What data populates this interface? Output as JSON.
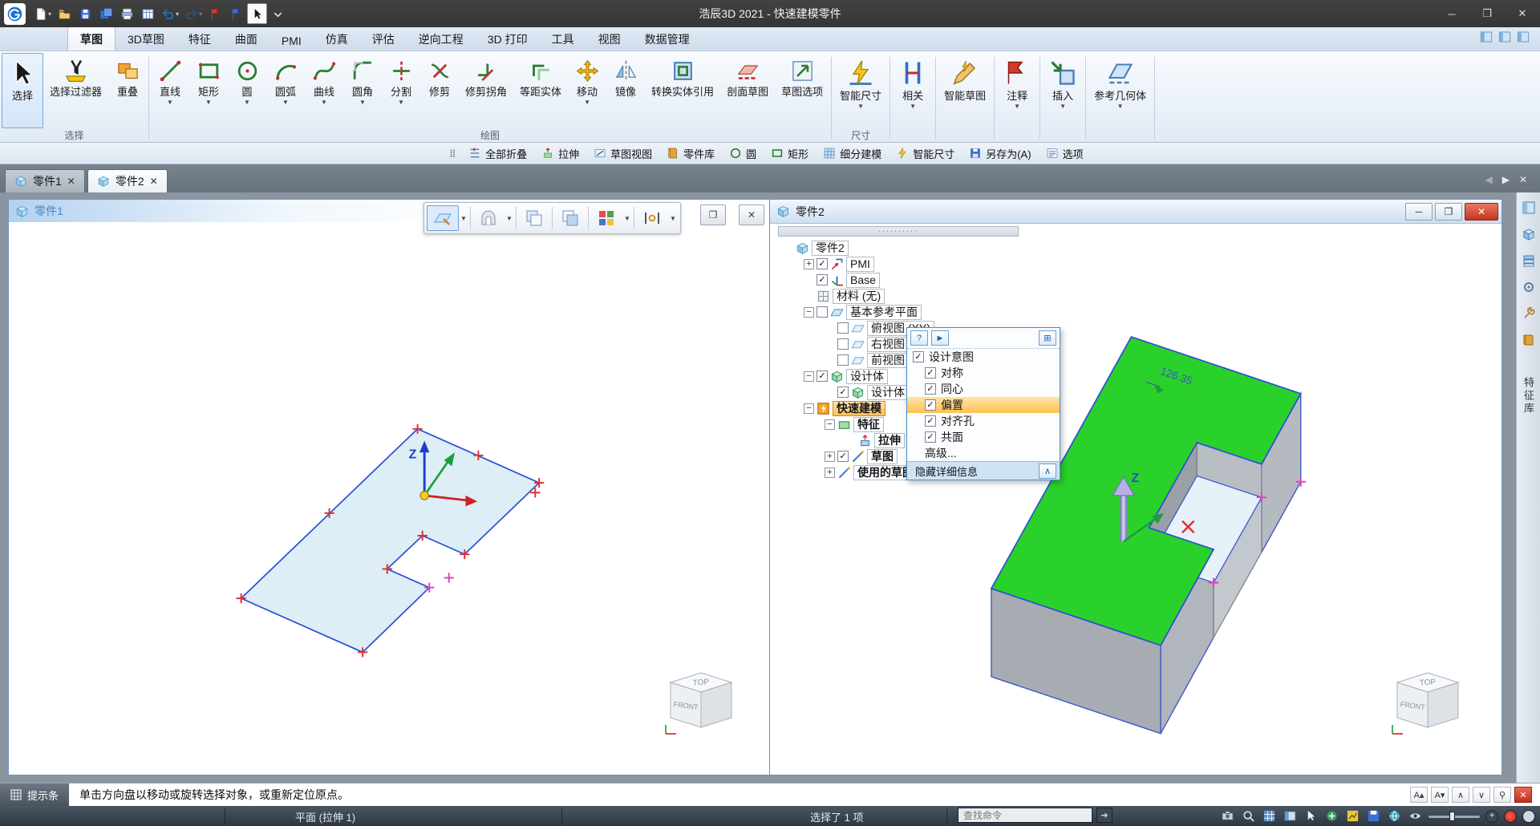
{
  "colors": {
    "accent": "#2a6fc9",
    "model_green": "#2ad12a",
    "highlight_orange": "#ffc14f",
    "close_red": "#c23420",
    "sketch_fill": "#ddeef6"
  },
  "title_bar": {
    "title": "浩辰3D 2021 - 快速建模零件",
    "quick_access": [
      {
        "name": "new-document",
        "icon": "new",
        "dropdown": true
      },
      {
        "name": "open-file",
        "icon": "open"
      },
      {
        "name": "save",
        "icon": "save"
      },
      {
        "name": "save-all",
        "icon": "saveall"
      },
      {
        "name": "print",
        "icon": "print"
      },
      {
        "name": "print-preview",
        "icon": "table"
      },
      {
        "name": "undo",
        "icon": "undo",
        "dropdown": true
      },
      {
        "name": "redo",
        "icon": "redo",
        "dropdown": true,
        "disabled": true
      },
      {
        "name": "markup-red",
        "icon": "flagred"
      },
      {
        "name": "markup-manager",
        "icon": "flagblue"
      },
      {
        "name": "select-tool",
        "icon": "cursorbox",
        "pressed": true
      },
      {
        "name": "customize-quick-access",
        "icon": "ddonly"
      }
    ],
    "window_controls": [
      {
        "name": "minimize",
        "glyph": "─"
      },
      {
        "name": "restore",
        "glyph": "❐"
      },
      {
        "name": "close",
        "glyph": "✕"
      }
    ]
  },
  "ribbon": {
    "tabs": [
      {
        "name": "sketch",
        "label": "草图",
        "active": true
      },
      {
        "name": "sketch-3d",
        "label": "3D草图"
      },
      {
        "name": "feature",
        "label": "特征"
      },
      {
        "name": "surface",
        "label": "曲面"
      },
      {
        "name": "pmi",
        "label": "PMI"
      },
      {
        "name": "simulation",
        "label": "仿真"
      },
      {
        "name": "evaluate",
        "label": "评估"
      },
      {
        "name": "reverse-engineering",
        "label": "逆向工程"
      },
      {
        "name": "print-3d",
        "label": "3D 打印"
      },
      {
        "name": "tools",
        "label": "工具"
      },
      {
        "name": "view",
        "label": "视图"
      },
      {
        "name": "data-management",
        "label": "数据管理"
      }
    ],
    "groups": [
      {
        "label": "选择",
        "tools": [
          {
            "name": "select",
            "label": "选择",
            "icon": "select",
            "big": true,
            "pressed": true
          },
          {
            "name": "select-filter",
            "label": "选择过滤器",
            "icon": "filter"
          },
          {
            "name": "overlap",
            "label": "重叠",
            "icon": "overlap"
          }
        ]
      },
      {
        "label": "绘图",
        "tools": [
          {
            "name": "line",
            "label": "直线",
            "icon": "line",
            "dropdown": true
          },
          {
            "name": "rectangle",
            "label": "矩形",
            "icon": "rect",
            "dropdown": true
          },
          {
            "name": "circle",
            "label": "圆",
            "icon": "circle",
            "dropdown": true
          },
          {
            "name": "arc",
            "label": "圆弧",
            "icon": "arc",
            "dropdown": true
          },
          {
            "name": "curve",
            "label": "曲线",
            "icon": "curve",
            "dropdown": true
          },
          {
            "name": "fillet",
            "label": "圆角",
            "icon": "fillet",
            "dropdown": true
          },
          {
            "name": "split",
            "label": "分割",
            "icon": "split",
            "dropdown": true
          },
          {
            "name": "trim",
            "label": "修剪",
            "icon": "trim"
          },
          {
            "name": "trim-corner",
            "label": "修剪拐角",
            "icon": "trimcorner"
          },
          {
            "name": "offset-entities",
            "label": "等距实体",
            "icon": "offset"
          },
          {
            "name": "move",
            "label": "移动",
            "icon": "move",
            "dropdown": true
          },
          {
            "name": "mirror",
            "label": "镜像",
            "icon": "mirror"
          },
          {
            "name": "convert-entities",
            "label": "转换实体引用",
            "icon": "convert"
          },
          {
            "name": "section-sketch",
            "label": "剖面草图",
            "icon": "section"
          },
          {
            "name": "sketch-options",
            "label": "草图选项",
            "icon": "sketchopts"
          }
        ]
      },
      {
        "label": "尺寸",
        "tools": [
          {
            "name": "smart-dimension",
            "label": "智能尺寸",
            "icon": "smartdim",
            "big": true,
            "dropdown": true
          }
        ]
      },
      {
        "label": "",
        "tools": [
          {
            "name": "relate",
            "label": "相关",
            "icon": "relate",
            "big": true,
            "dropdown": true
          }
        ]
      },
      {
        "label": "",
        "tools": [
          {
            "name": "smart-sketch",
            "label": "智能草图",
            "icon": "smarts",
            "big": true
          }
        ]
      },
      {
        "label": "",
        "tools": [
          {
            "name": "annotation",
            "label": "注释",
            "icon": "annotate",
            "big": true,
            "dropdown": true
          }
        ]
      },
      {
        "label": "",
        "tools": [
          {
            "name": "insert",
            "label": "插入",
            "icon": "insert",
            "big": true,
            "dropdown": true
          }
        ]
      },
      {
        "label": "",
        "tools": [
          {
            "name": "reference-geometry",
            "label": "参考几何体",
            "icon": "refgeo",
            "big": true,
            "dropdown": true
          }
        ]
      }
    ]
  },
  "quick_toolbar": {
    "items": [
      {
        "name": "collapse-all",
        "label": "全部折叠",
        "icon": "collapse"
      },
      {
        "name": "extrude",
        "label": "拉伸",
        "icon": "extrudesm"
      },
      {
        "name": "sketch-view",
        "label": "草图视图",
        "icon": "sketchview"
      },
      {
        "name": "part-library",
        "label": "零件库",
        "icon": "library"
      },
      {
        "name": "circle-cmd",
        "label": "圆",
        "icon": "circlesm"
      },
      {
        "name": "rectangle-cmd",
        "label": "矩形",
        "icon": "rectsm"
      },
      {
        "name": "subdivision-modeling",
        "label": "细分建模",
        "icon": "subdiv"
      },
      {
        "name": "smart-dimension-cmd",
        "label": "智能尺寸",
        "icon": "smartdimsm"
      },
      {
        "name": "save-as",
        "label": "另存为(A)",
        "icon": "saveas"
      },
      {
        "name": "options",
        "label": "选项",
        "icon": "options"
      }
    ]
  },
  "document_tabs": {
    "tabs": [
      {
        "name": "part1",
        "label": "零件1"
      },
      {
        "name": "part2",
        "label": "零件2",
        "active": true
      }
    ],
    "nav": {
      "back": "◀",
      "forward": "▶",
      "close": "✕"
    }
  },
  "left_window": {
    "title": "零件1",
    "axis_label": "Z",
    "view_cube": {
      "top": "TOP",
      "front": "FRONT"
    },
    "toolbar": [
      {
        "name": "sketch-plane",
        "icon": "fplane",
        "dropdown": true,
        "pressed": true
      },
      {
        "name": "profile-mode",
        "icon": "farch",
        "dropdown": true
      },
      {
        "name": "copy-mode-a",
        "icon": "fcopya"
      },
      {
        "name": "copy-mode-b",
        "icon": "fcopyb"
      },
      {
        "name": "display-style",
        "icon": "fgrid",
        "dropdown": true
      },
      {
        "name": "measure",
        "icon": "fmeasure",
        "dropdown": true
      }
    ],
    "window_buttons": [
      {
        "name": "maximize",
        "glyph": "❐"
      },
      {
        "name": "close",
        "glyph": "✕"
      }
    ]
  },
  "right_window": {
    "title": "零件2",
    "axis_label": "Z",
    "dimension_label": "126.35",
    "view_cube": {
      "top": "TOP",
      "front": "FRONT"
    },
    "window_buttons": [
      {
        "name": "minimize",
        "glyph": "─"
      },
      {
        "name": "restore",
        "glyph": "❐"
      },
      {
        "name": "close",
        "glyph": "✕"
      }
    ],
    "tree": [
      {
        "name": "root-part2",
        "label": "零件2",
        "icon": "tpart",
        "level": 0
      },
      {
        "name": "pmi",
        "label": "PMI",
        "icon": "tpmi",
        "level": 1,
        "expander": "+",
        "checkbox": "checked"
      },
      {
        "name": "base",
        "label": "Base",
        "icon": "tbase",
        "level": 1,
        "checkbox": "checked"
      },
      {
        "name": "material",
        "label": "材料 (无)",
        "icon": "tmaterial",
        "level": 1
      },
      {
        "name": "base-reference-planes",
        "label": "基本参考平面",
        "icon": "tplanes",
        "level": 1,
        "expander": "-",
        "checkbox": "unchecked"
      },
      {
        "name": "top-view",
        "label": "俯视图 (XY)",
        "icon": "tplane",
        "level": 2,
        "checkbox": "unchecked"
      },
      {
        "name": "right-view",
        "label": "右视图",
        "icon": "tplane",
        "level": 2,
        "checkbox": "unchecked"
      },
      {
        "name": "front-view",
        "label": "前视图",
        "icon": "tplane",
        "level": 2,
        "checkbox": "unchecked"
      },
      {
        "name": "design-body",
        "label": "设计体",
        "icon": "tbody",
        "level": 1,
        "expander": "-",
        "checkbox": "checked"
      },
      {
        "name": "design-body-1",
        "label": "设计体 1",
        "icon": "tbody",
        "level": 2,
        "checkbox": "checked"
      },
      {
        "name": "quick-modeling",
        "label": "快速建模",
        "icon": "tquick",
        "level": 1,
        "expander": "-",
        "highlighted": true,
        "bold": true
      },
      {
        "name": "features",
        "label": "特征",
        "icon": "tfeature",
        "level": 2,
        "expander": "-",
        "bold": true
      },
      {
        "name": "extrude-1",
        "label": "拉伸",
        "icon": "textrude",
        "level": 3,
        "bold": true
      },
      {
        "name": "sketches",
        "label": "草图",
        "icon": "tsketch",
        "level": 2,
        "expander": "+",
        "checkbox": "checked",
        "bold": true
      },
      {
        "name": "used-sketches",
        "label": "使用的草图",
        "icon": "tsketch",
        "level": 2,
        "expander": "+",
        "bold": true
      }
    ],
    "popup": {
      "header_buttons": [
        {
          "name": "help",
          "glyph": "?"
        },
        {
          "name": "play",
          "glyph": "►"
        }
      ],
      "pin_glyph": "⊞",
      "items": [
        {
          "name": "design-intent",
          "label": "设计意图",
          "checked": true,
          "header": true
        },
        {
          "name": "symmetric",
          "label": "对称",
          "checked": true
        },
        {
          "name": "concentric",
          "label": "同心",
          "checked": true
        },
        {
          "name": "offset",
          "label": "偏置",
          "checked": true,
          "highlighted": true
        },
        {
          "name": "align-holes",
          "label": "对齐孔",
          "checked": true
        },
        {
          "name": "coplanar",
          "label": "共面",
          "checked": true
        }
      ],
      "advanced_label": "高级...",
      "footer": {
        "label": "隐藏详细信息",
        "collapse_glyph": "∧"
      }
    }
  },
  "side_strip": {
    "label": "特征库"
  },
  "prompt_bar": {
    "badge": "提示条",
    "message": "单击方向盘以移动或旋转选择对象，或重新定位原点。",
    "buttons": [
      {
        "name": "font-increase",
        "glyph": "A▴"
      },
      {
        "name": "font-decrease",
        "glyph": "A▾"
      },
      {
        "name": "scroll-up",
        "glyph": "∧"
      },
      {
        "name": "scroll-down",
        "glyph": "∨"
      },
      {
        "name": "pin",
        "glyph": "⚲"
      },
      {
        "name": "close",
        "glyph": "✕"
      }
    ]
  },
  "status_bar": {
    "left": "平面 (拉伸 1)",
    "selection": "选择了 1 项",
    "search_placeholder": "查找命令",
    "go_glyph": "➜"
  }
}
